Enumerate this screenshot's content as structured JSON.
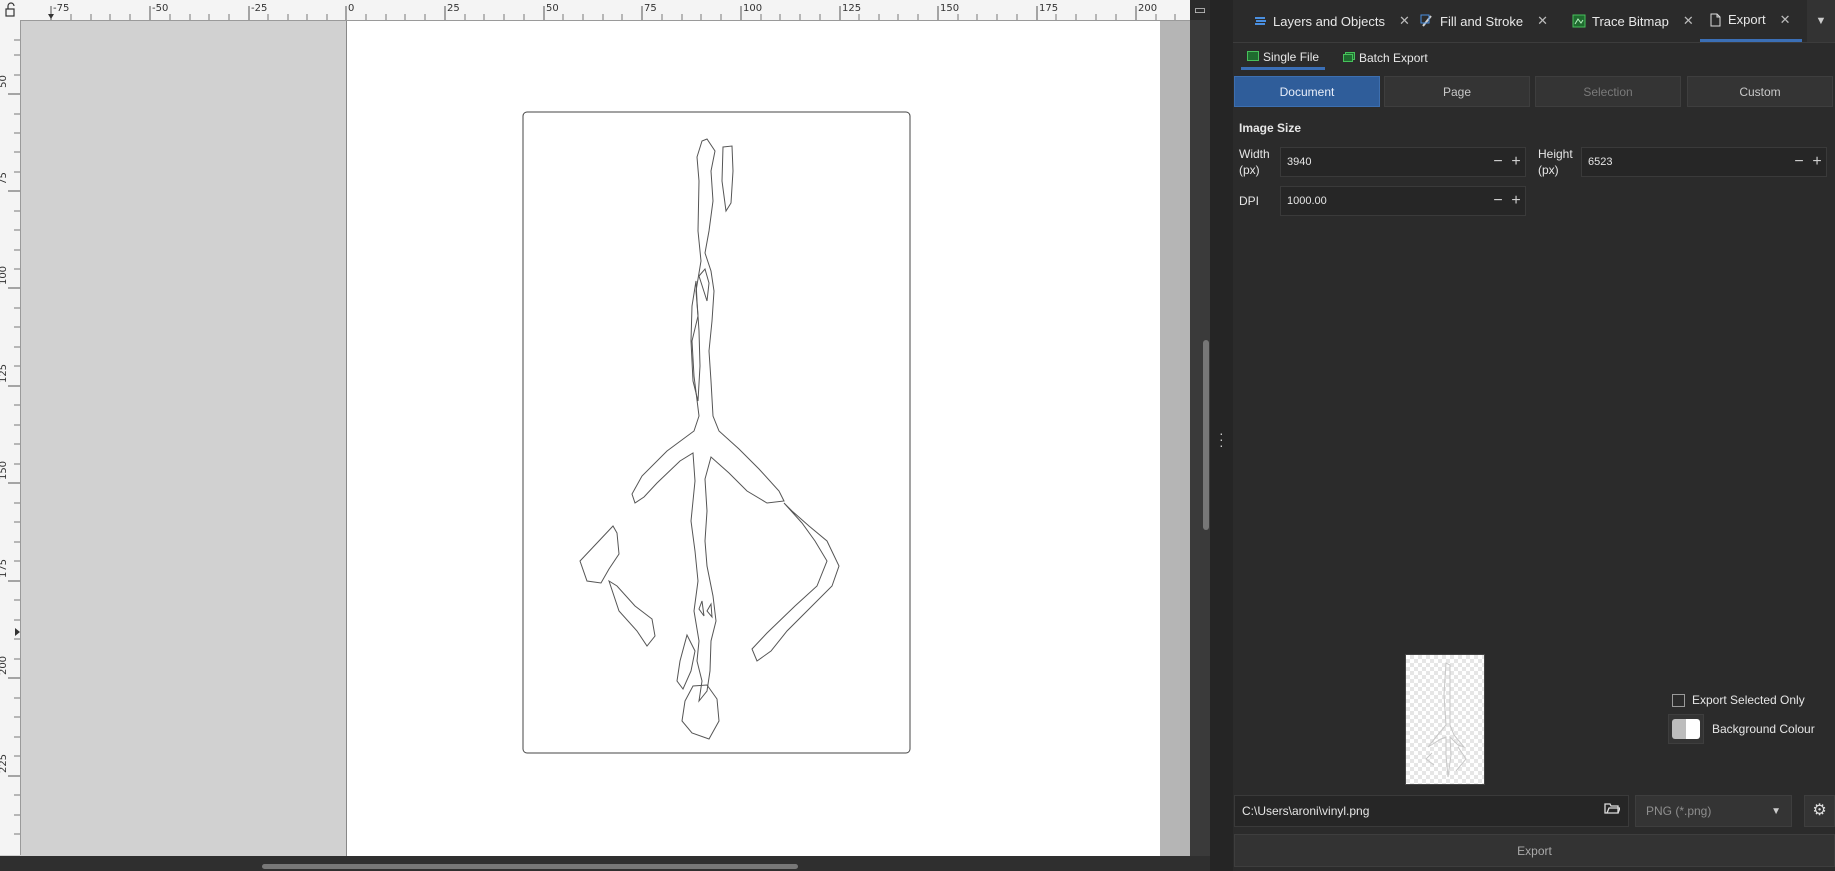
{
  "rulers": {
    "top": [
      "-75",
      "-50",
      "-25",
      "0",
      "25",
      "50",
      "75",
      "100",
      "125",
      "150",
      "175",
      "200"
    ],
    "left": [
      "50",
      "75",
      "100",
      "125",
      "150",
      "175",
      "200",
      "225"
    ]
  },
  "dock": {
    "tabs": [
      {
        "label": "Layers and Objects",
        "icon": "layers-icon"
      },
      {
        "label": "Fill and Stroke",
        "icon": "fill-stroke-icon"
      },
      {
        "label": "Trace Bitmap",
        "icon": "trace-bitmap-icon"
      },
      {
        "label": "Export",
        "icon": "export-icon",
        "active": true
      }
    ]
  },
  "export": {
    "subtabs": {
      "single": "Single File",
      "batch": "Batch Export"
    },
    "modes": {
      "document": "Document",
      "page": "Page",
      "selection": "Selection",
      "custom": "Custom"
    },
    "image_size_title": "Image Size",
    "width_label": "Width\n(px)",
    "width_value": "3940",
    "height_label": "Height\n(px)",
    "height_value": "6523",
    "dpi_label": "DPI",
    "dpi_value": "1000.00",
    "export_selected_only": "Export Selected Only",
    "background_colour": "Background Colour",
    "filename": "C:\\Users\\aroni\\vinyl.png",
    "format": "PNG (*.png)",
    "export_button": "Export"
  },
  "colors": {
    "accent": "#3b6fb6",
    "active_mode_bg": "#2f5d9a",
    "panel_bg": "#2b2b2b",
    "canvas_bg": "#d1d1d1"
  }
}
